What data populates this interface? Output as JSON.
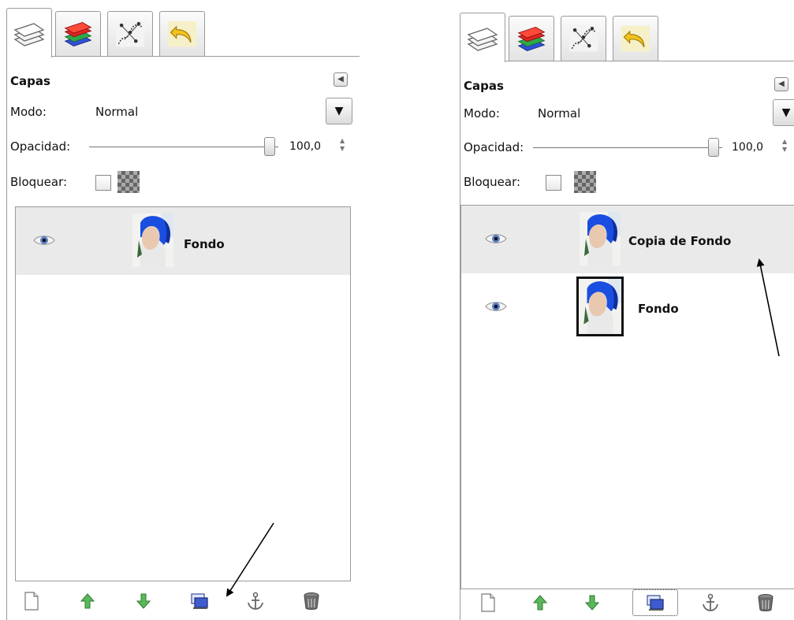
{
  "left_panel": {
    "tabs": [
      {
        "icon": "layers-icon"
      },
      {
        "icon": "channels-icon"
      },
      {
        "icon": "paths-icon"
      },
      {
        "icon": "undo-history-icon"
      }
    ],
    "title": "Capas",
    "mode_label": "Modo:",
    "mode_value": "Normal",
    "opacity_label": "Opacidad:",
    "opacity_value": "100,0",
    "lock_label": "Bloquear:",
    "layers": [
      {
        "name": "Fondo",
        "visible": true,
        "selected": true
      }
    ],
    "bottom_buttons": [
      {
        "icon": "new-layer-icon"
      },
      {
        "icon": "raise-layer-icon"
      },
      {
        "icon": "lower-layer-icon"
      },
      {
        "icon": "duplicate-layer-icon"
      },
      {
        "icon": "anchor-layer-icon"
      },
      {
        "icon": "delete-layer-icon"
      }
    ]
  },
  "right_panel": {
    "tabs": [
      {
        "icon": "layers-icon"
      },
      {
        "icon": "channels-icon"
      },
      {
        "icon": "paths-icon"
      },
      {
        "icon": "undo-history-icon"
      }
    ],
    "title": "Capas",
    "mode_label": "Modo:",
    "mode_value": "Normal",
    "opacity_label": "Opacidad:",
    "opacity_value": "100,0",
    "lock_label": "Bloquear:",
    "layers": [
      {
        "name": "Copia de Fondo",
        "visible": true,
        "selected": true
      },
      {
        "name": "Fondo",
        "visible": true,
        "selected": false
      }
    ],
    "bottom_buttons": [
      {
        "icon": "new-layer-icon"
      },
      {
        "icon": "raise-layer-icon"
      },
      {
        "icon": "lower-layer-icon"
      },
      {
        "icon": "duplicate-layer-icon"
      },
      {
        "icon": "anchor-layer-icon"
      },
      {
        "icon": "delete-layer-icon"
      }
    ]
  },
  "colors": {
    "selected_row": "#eaeaea",
    "border": "#9a9a9a",
    "arrow_up": "#4aa84a",
    "arrow_down": "#3f9d3f"
  }
}
